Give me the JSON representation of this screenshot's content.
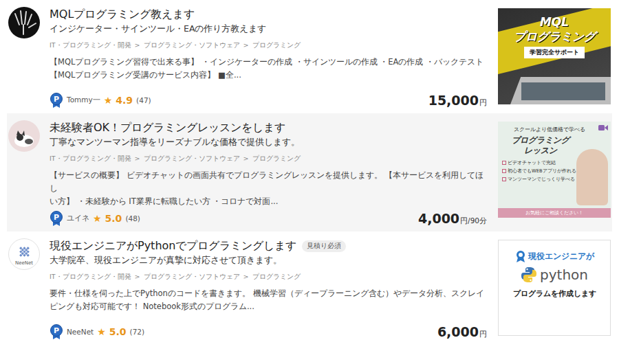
{
  "listings": [
    {
      "hovered": false,
      "avatar": {
        "kind": "photo",
        "label": ""
      },
      "title": "MQLプログラミング教えます",
      "tag": "",
      "subtitle": "インジケーター・サインツール・EAの作り方教えます",
      "breadcrumbs": [
        "IT・プログラミング・開発",
        "プログラミング・ソフトウェア",
        "プログラミング"
      ],
      "separator": ">",
      "description": [
        "【MQLプログラミング習得で出来る事】 ・インジケーターの作成 ・サインツールの作成 ・EAの作成 ・バックテスト",
        "【MQLプログラミング受講のサービス内容】 ■全..."
      ],
      "seller": {
        "badge": "P",
        "name": "Tommy一",
        "star": "★",
        "rating": "4.9",
        "count": "(47)"
      },
      "price": {
        "amount": "15,000",
        "unit": "円"
      },
      "thumbnail": {
        "kind": "mql",
        "texts": [
          "MQL",
          "プログラミング",
          "学習完全サポート"
        ]
      }
    },
    {
      "hovered": true,
      "avatar": {
        "kind": "illustration",
        "label": ""
      },
      "title": "未経験者OK！プログラミングレッスンをします",
      "tag": "",
      "subtitle": "丁寧なマンツーマン指導をリーズナブルな価格で提供します。",
      "breadcrumbs": [
        "IT・プログラミング・開発",
        "プログラミング・ソフトウェア",
        "プログラミング"
      ],
      "separator": ">",
      "description": [
        "【サービスの概要】 ビデオチャットの画面共有でプログラミングレッスンを提供します。 【本サービスを利用してほし",
        "い方】 ・未経験から IT業界に転職したい方 ・コロナで対面..."
      ],
      "seller": {
        "badge": "P",
        "name": "ユイネ",
        "star": "★",
        "rating": "5.0",
        "count": "(48)"
      },
      "price": {
        "amount": "4,000",
        "unit": "円/90分"
      },
      "thumbnail": {
        "kind": "lesson",
        "texts": [
          "スクールより低価格で学べる",
          "プログラミング",
          "レッスン",
          "ビデオチャットで完結",
          "初心者でもWEBアプリが作れる",
          "マンツーマンでじっくり学べる",
          "お気軽にご相談ください！"
        ]
      }
    },
    {
      "hovered": false,
      "avatar": {
        "kind": "logo",
        "label": "NeeNet"
      },
      "title": "現役エンジニアがPythonでプログラミングします",
      "tag": "見積り必須",
      "subtitle": "大学院卒、現役エンジニアが真摯に対応させて頂きます。",
      "breadcrumbs": [
        "IT・プログラミング・開発",
        "プログラミング・ソフトウェア",
        "プログラミング"
      ],
      "separator": ">",
      "description": [
        "要件・仕様を伺った上でPythonのコードを書きます。 機械学習（ディープラーニング含む）やデータ分析、スクレイ",
        "ピングも対応可能です！ Notebook形式のプログラム..."
      ],
      "seller": {
        "badge": "P",
        "name": "NeeNet",
        "star": "★",
        "rating": "5.0",
        "count": "(72)"
      },
      "price": {
        "amount": "6,000",
        "unit": "円"
      },
      "thumbnail": {
        "kind": "python",
        "texts": [
          "現役エンジニアが",
          "python",
          "プログラムを作成します"
        ]
      }
    }
  ]
}
